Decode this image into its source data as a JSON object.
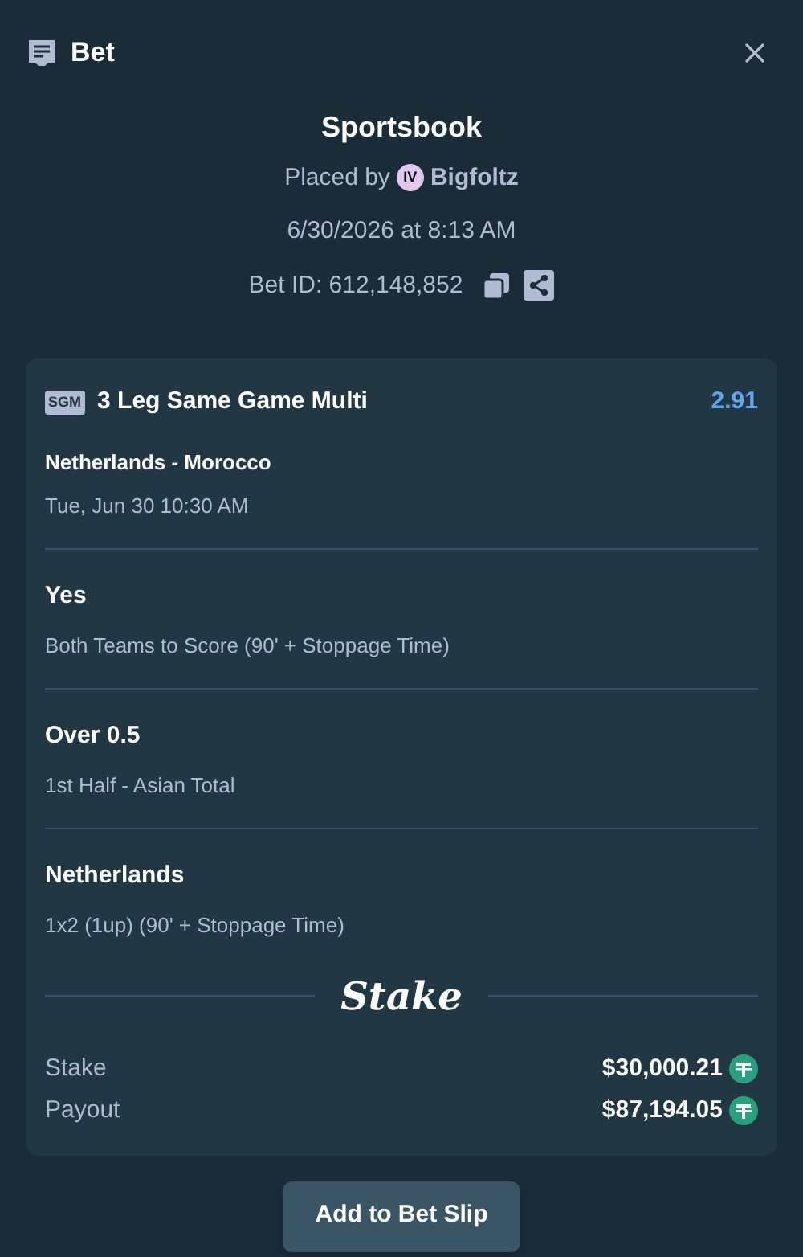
{
  "header": {
    "title": "Bet"
  },
  "summary": {
    "source": "Sportsbook",
    "placed_by": "Placed by",
    "user_badge": "IV",
    "user": "Bigfoltz",
    "datetime": "6/30/2026 at 8:13 AM",
    "bet_id": "Bet ID: 612,148,852"
  },
  "bet": {
    "type_badge": "SGM",
    "title": "3 Leg Same Game Multi",
    "odds": "2.91",
    "event": "Netherlands - Morocco",
    "event_time": "Tue, Jun 30 10:30 AM",
    "legs": [
      {
        "selection": "Yes",
        "market": "Both Teams to Score (90' + Stoppage Time)"
      },
      {
        "selection": "Over 0.5",
        "market": "1st Half - Asian Total"
      },
      {
        "selection": "Netherlands",
        "market": "1x2 (1up) (90' + Stoppage Time)"
      }
    ],
    "brand": "Stake",
    "totals": [
      {
        "label": "Stake",
        "amount": "$30,000.21"
      },
      {
        "label": "Payout",
        "amount": "$87,194.05"
      }
    ]
  },
  "button": "Add to Bet Slip"
}
